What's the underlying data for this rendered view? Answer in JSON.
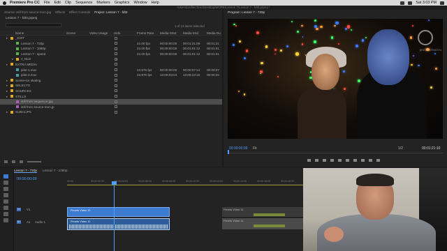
{
  "menubar": {
    "app": "Premiere Pro CC",
    "items": [
      "File",
      "Edit",
      "Clip",
      "Sequence",
      "Markers",
      "Graphics",
      "Window",
      "Help"
    ],
    "clock": "Sat 3:03 PM"
  },
  "path": "/Users/profitechnic/Desktop/WORK/Lesson 7/Lesson 7 - fdt3.prproj *",
  "project_tabs": [
    "Source: still from source-mon.jpg",
    "Effects",
    "Effect Controls",
    "Project: Lesson 7 - fdt3"
  ],
  "program_tab": "Program: Lesson 7 - 720p",
  "project": {
    "title": "Lesson 7 - fdt3.prproj",
    "selected_count": "1 of 13 items selected",
    "columns": [
      "Name",
      "Scene",
      "Video Usage",
      "Hide",
      "Frame Rate",
      "Media Start",
      "Media End",
      "Media Du"
    ],
    "rows": [
      {
        "name": "_EDIT",
        "type": "bin",
        "indent": 0,
        "color": "#e0a81f",
        "hide": "",
        "fps": "",
        "start": "",
        "end": "",
        "dur": "",
        "selected": false
      },
      {
        "name": "Lesson 7 - 720p",
        "type": "seq",
        "indent": 1,
        "color": "#5bb24b",
        "hide": "",
        "fps": "24.00 fps",
        "start": "00:00:00:00",
        "end": "00:01:21:09",
        "dur": "00:01:21",
        "selected": false
      },
      {
        "name": "Lesson 7 - 1080p",
        "type": "seq",
        "indent": 1,
        "color": "#5bb24b",
        "hide": "",
        "fps": "24.00 fps",
        "start": "00:00:00:00",
        "end": "00:01:01:12",
        "dur": "00:01:01",
        "selected": false
      },
      {
        "name": "Lesson 7 - speed",
        "type": "seq",
        "indent": 1,
        "color": "#5bb24b",
        "hide": "",
        "fps": "24.00 fps",
        "start": "00:00:00:00",
        "end": "00:01:01:12",
        "dur": "00:01:01",
        "selected": false
      },
      {
        "name": "z_OLD",
        "type": "bin",
        "indent": 1,
        "color": "#e0a81f",
        "hide": "✓",
        "fps": "",
        "start": "",
        "end": "",
        "dur": "",
        "selected": false
      },
      {
        "name": "EXTRA MEDIA",
        "type": "bin",
        "indent": 0,
        "color": "#e0a81f",
        "hide": "",
        "fps": "",
        "start": "",
        "end": "",
        "dur": "",
        "selected": false
      },
      {
        "name": "pilot-1.mov",
        "type": "clip",
        "indent": 1,
        "color": "#4aa0a8",
        "hide": "",
        "fps": "23.976 fps",
        "start": "00:00:00:00",
        "end": "00:00:07:14",
        "dur": "00:00:07",
        "selected": false
      },
      {
        "name": "pilot-2.mov",
        "type": "clip",
        "indent": 1,
        "color": "#4aa0a8",
        "hide": "",
        "fps": "23.976 fps",
        "start": "13:08:03:04",
        "end": "13:08:23:15",
        "dur": "00:00:20",
        "selected": false
      },
      {
        "name": "Scene-ice skating",
        "type": "bin",
        "indent": 0,
        "color": "#e0a81f",
        "hide": "",
        "fps": "",
        "start": "",
        "end": "",
        "dur": "",
        "selected": false
      },
      {
        "name": "SELECTS",
        "type": "bin",
        "indent": 0,
        "color": "#e0a81f",
        "hide": "",
        "fps": "",
        "start": "",
        "end": "",
        "dur": "",
        "selected": false
      },
      {
        "name": "SOURCES",
        "type": "bin",
        "indent": 0,
        "color": "#e0a81f",
        "hide": "",
        "fps": "",
        "start": "",
        "end": "",
        "dur": "",
        "selected": false
      },
      {
        "name": "STILLS",
        "type": "bin",
        "indent": 0,
        "color": "#e0a81f",
        "hide": "",
        "fps": "",
        "start": "",
        "end": "",
        "dur": "",
        "selected": false
      },
      {
        "name": "still from sequence.jpg",
        "type": "still",
        "indent": 1,
        "color": "#b05bbd",
        "hide": "",
        "fps": "",
        "start": "",
        "end": "",
        "dur": "",
        "selected": true
      },
      {
        "name": "still from source-mon.jp",
        "type": "still",
        "indent": 1,
        "color": "#b05bbd",
        "hide": "",
        "fps": "",
        "start": "",
        "end": "",
        "dur": "",
        "selected": false
      },
      {
        "name": "SUBCLIPS",
        "type": "bin",
        "indent": 0,
        "color": "#e0a81f",
        "hide": "",
        "fps": "",
        "start": "",
        "end": "",
        "dur": "",
        "selected": false
      }
    ]
  },
  "program": {
    "timecode": "00:00:00:09",
    "fit": "Fit",
    "quality": "1/2",
    "duration": "00:01:21:10",
    "watermark": "profileschool.ru"
  },
  "timeline": {
    "tabs": [
      "Lesson 7 - 720p",
      "Lesson 7 - 1080p"
    ],
    "timecode": "00:00:00:09",
    "ruler": [
      "00:00",
      "00:00:02:00",
      "00:00:04:00",
      "00:00:06:00",
      "00:00:08:00",
      "00:00:10:00",
      "00:00:12:00",
      "00:00:14:00",
      "00:00:16:00",
      "00:00:18:00",
      "00:00:20:00",
      "00:00:22:00",
      "00:00:24:00",
      "00:00:26:00",
      "00:00:28:00",
      "00:00:30:00"
    ],
    "tracks": [
      {
        "id": "V1",
        "name": "V1"
      },
      {
        "id": "A1",
        "name": "A1",
        "label": "Audio 1"
      }
    ],
    "clips": {
      "video": "Pexels Video 11",
      "audio": "Pexels Video 11",
      "right_video": "Pexels Video 11",
      "right_audio": "Pexels Video 11"
    },
    "accent": "#4ea0ff"
  }
}
